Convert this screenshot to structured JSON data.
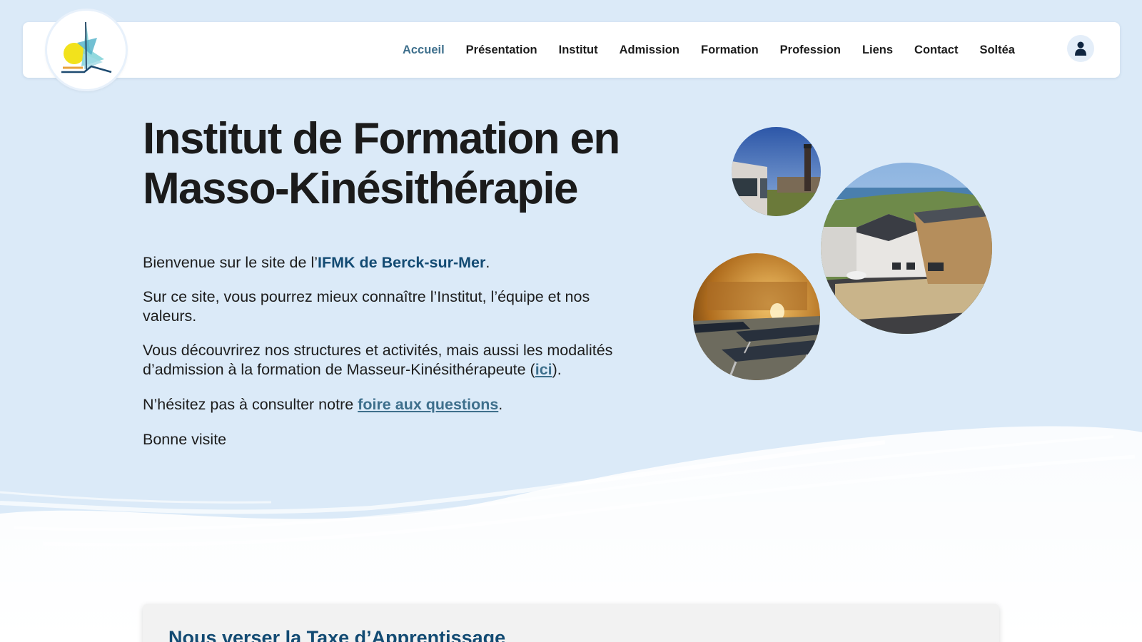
{
  "nav": {
    "items": [
      {
        "label": "Accueil",
        "active": true
      },
      {
        "label": "Présentation",
        "active": false
      },
      {
        "label": "Institut",
        "active": false
      },
      {
        "label": "Admission",
        "active": false
      },
      {
        "label": "Formation",
        "active": false
      },
      {
        "label": "Profession",
        "active": false
      },
      {
        "label": "Liens",
        "active": false
      },
      {
        "label": "Contact",
        "active": false
      },
      {
        "label": "Soltéa",
        "active": false
      }
    ],
    "user_icon": "user-icon"
  },
  "hero": {
    "title_line1": "Institut de Formation en",
    "title_line2": "Masso-Kinésithérapie",
    "p1_prefix": "Bienvenue sur le site de l’",
    "p1_link": "IFMK de Berck-sur-Mer",
    "p1_suffix": ".",
    "p2": "Sur ce site, vous pourrez mieux connaître l’Institut, l’équipe et nos valeurs.",
    "p3_prefix": "Vous découvrirez nos structures et activités, mais aussi les modalités d’admission à la formation de Masseur-Kinésithérapeute (",
    "p3_link": "ici",
    "p3_suffix": ").",
    "p4_prefix": "N’hésitez pas à consulter notre ",
    "p4_link": "foire aux questions",
    "p4_suffix": ".",
    "p5": "Bonne visite"
  },
  "card": {
    "title": "Nous verser la Taxe d’Apprentissage"
  },
  "colors": {
    "background": "#dbeaf8",
    "accent": "#134b73",
    "active_nav": "#3e6f8c"
  }
}
